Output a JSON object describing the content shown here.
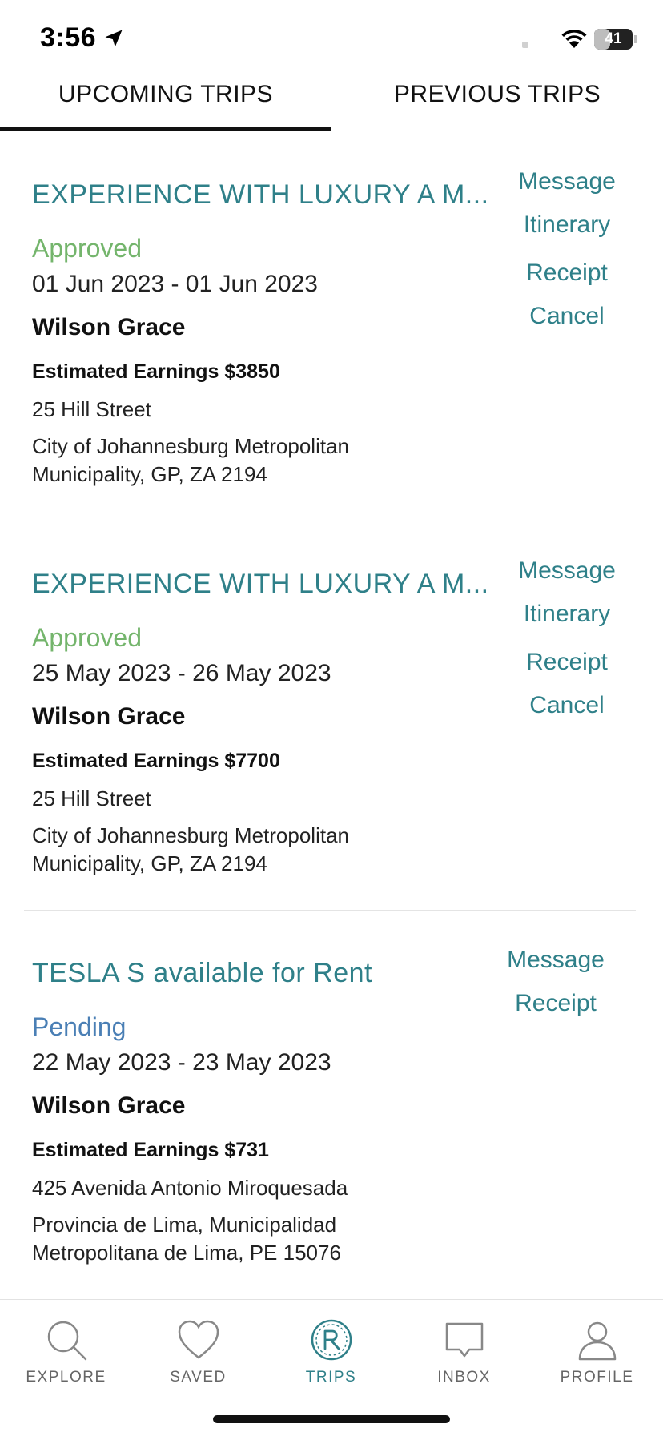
{
  "status": {
    "time": "3:56",
    "battery": "41",
    "battery_level": 0.41
  },
  "tabs": {
    "upcoming": "UPCOMING TRIPS",
    "previous": "PREVIOUS TRIPS"
  },
  "colors": {
    "accent": "#2f8089",
    "approved": "#74b56c",
    "pending": "#4a7fb5"
  },
  "trips": [
    {
      "title": "EXPERIENCE WITH LUXURY A M...",
      "status": "Approved",
      "dates": "01 Jun 2023 - 01 Jun 2023",
      "guest": "Wilson Grace",
      "earnings": "Estimated Earnings $3850",
      "street": "25 Hill Street",
      "city_line1": "City of Johannesburg Metropolitan",
      "city_line2": "Municipality, GP, ZA 2194",
      "actions": {
        "message": "Message",
        "itinerary": "Itinerary",
        "receipt": "Receipt",
        "cancel": "Cancel"
      }
    },
    {
      "title": "EXPERIENCE WITH LUXURY A M...",
      "status": "Approved",
      "dates": "25 May 2023 - 26 May 2023",
      "guest": "Wilson Grace",
      "earnings": "Estimated Earnings $7700",
      "street": "25 Hill Street",
      "city_line1": "City of Johannesburg Metropolitan",
      "city_line2": "Municipality, GP, ZA 2194",
      "actions": {
        "message": "Message",
        "itinerary": "Itinerary",
        "receipt": "Receipt",
        "cancel": "Cancel"
      }
    },
    {
      "title": "TESLA S available for Rent",
      "status": "Pending",
      "dates": "22 May 2023 - 23 May 2023",
      "guest": "Wilson Grace",
      "earnings": "Estimated Earnings $731",
      "street": "425 Avenida Antonio Miroquesada",
      "city_line1": "Provincia de Lima, Municipalidad",
      "city_line2": "Metropolitana de Lima, PE 15076",
      "actions": {
        "message": "Message",
        "receipt": "Receipt"
      }
    }
  ],
  "nav": [
    {
      "label": "EXPLORE",
      "icon": "search-icon"
    },
    {
      "label": "SAVED",
      "icon": "heart-icon"
    },
    {
      "label": "TRIPS",
      "icon": "trips-logo-icon",
      "active": true
    },
    {
      "label": "INBOX",
      "icon": "chat-bubble-icon"
    },
    {
      "label": "PROFILE",
      "icon": "person-icon"
    }
  ]
}
